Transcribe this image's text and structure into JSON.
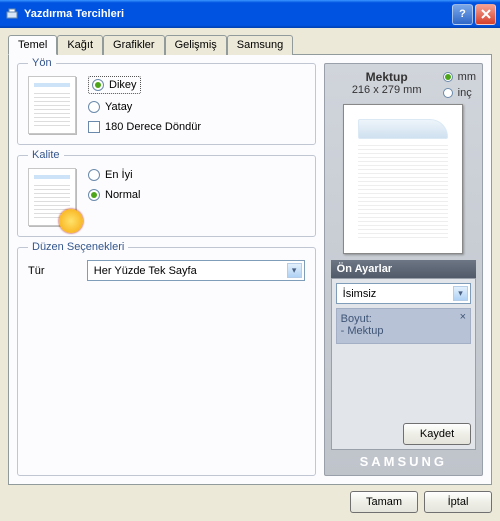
{
  "window": {
    "title": "Yazdırma Tercihleri"
  },
  "tabs": [
    "Temel",
    "Kağıt",
    "Grafikler",
    "Gelişmiş",
    "Samsung"
  ],
  "orientation": {
    "group": "Yön",
    "portrait": "Dikey",
    "landscape": "Yatay",
    "rotate": "180 Derece Döndür"
  },
  "quality": {
    "group": "Kalite",
    "best": "En İyi",
    "normal": "Normal"
  },
  "layout": {
    "group": "Düzen Seçenekleri",
    "type_label": "Tür",
    "type_value": "Her Yüzde Tek Sayfa"
  },
  "paper": {
    "name": "Mektup",
    "dims": "216 x 279 mm",
    "unit_mm": "mm",
    "unit_in": "inç"
  },
  "presets": {
    "title": "Ön Ayarlar",
    "value": "İsimsiz",
    "info_label": "Boyut:",
    "info_value": "- Mektup",
    "save": "Kaydet"
  },
  "brand": "SAMSUNG",
  "footer": {
    "ok": "Tamam",
    "cancel": "İptal"
  }
}
